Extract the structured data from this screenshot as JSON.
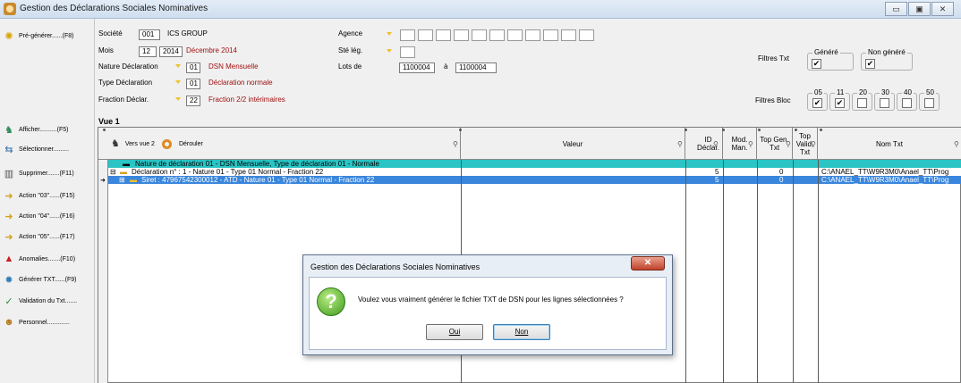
{
  "window": {
    "title": "Gestion des Déclarations Sociales Nominatives",
    "buttons": {
      "minimize": "▭",
      "maximize": "▣",
      "close": "✕"
    }
  },
  "sidebar": {
    "items": [
      {
        "label": "Pré-générer......(F8)",
        "icon": "gear-icon"
      },
      {
        "label": "Afficher..........(F5)",
        "icon": "binoculars-icon"
      },
      {
        "label": "Sélectionner.........",
        "icon": "select-icon"
      },
      {
        "label": "Supprimer.......(F11)",
        "icon": "trash-icon"
      },
      {
        "label": "Action \"03\"......(F15)",
        "icon": "arrow-right-icon"
      },
      {
        "label": "Action \"04\"......(F16)",
        "icon": "arrow-right-icon"
      },
      {
        "label": "Action \"05\"......(F17)",
        "icon": "arrow-right-icon"
      },
      {
        "label": "Anomalies.......(F10)",
        "icon": "warning-icon"
      },
      {
        "label": "Générer TXT......(F9)",
        "icon": "cog-icon"
      },
      {
        "label": "Validation du Txt.......",
        "icon": "check-circle-icon"
      },
      {
        "label": "Personnel.............",
        "icon": "people-icon"
      }
    ]
  },
  "form": {
    "societe": {
      "label": "Société",
      "code": "001",
      "name": "ICS GROUP"
    },
    "mois": {
      "label": "Mois",
      "month": "12",
      "year": "2014",
      "text": "Décembre 2014"
    },
    "nature": {
      "label": "Nature Déclaration",
      "code": "01",
      "text": "DSN Mensuelle"
    },
    "type": {
      "label": "Type Déclaration",
      "code": "01",
      "text": "Déclaration normale"
    },
    "fraction": {
      "label": "Fraction Déclar.",
      "code": "22",
      "text": "Fraction 2/2 intérimaires"
    },
    "agence": {
      "label": "Agence"
    },
    "steleg": {
      "label": "Sté lég."
    },
    "lots": {
      "label": "Lots de",
      "from": "1100004",
      "sep": "à",
      "to": "1100004"
    },
    "filtres_txt": {
      "label": "Filtres Txt",
      "genere": "Généré",
      "non_genere": "Non généré",
      "genere_checked": "✔",
      "non_genere_checked": "✔"
    },
    "filtres_bloc": {
      "label": "Filtres Bloc",
      "blocs": [
        {
          "code": "05",
          "mark": "✔"
        },
        {
          "code": "11",
          "mark": "✔"
        },
        {
          "code": "20",
          "mark": ""
        },
        {
          "code": "30",
          "mark": ""
        },
        {
          "code": "40",
          "mark": ""
        },
        {
          "code": "50",
          "mark": ""
        }
      ]
    }
  },
  "grid": {
    "vue_title": "Vue 1",
    "toolbar": {
      "vers_vue": "Vers vue 2",
      "derouler": "Dérouler"
    },
    "columns": {
      "valeur": "Valeur",
      "id_declar": "ID Déclar.",
      "mod_man": "Mod. Man.",
      "top_gen": "Top Gen. Txt",
      "top_valid": "Top Valid. Txt",
      "nom_txt": "Nom Txt"
    },
    "rows": [
      {
        "label": "Nature de déclaration 01 - DSN Mensuelle, Type de déclaration 01 - Normale",
        "id": "",
        "top_gen": "",
        "nom_txt": ""
      },
      {
        "label": "Déclaration n° : 1 - Nature 01 - Type 01 Normal - Fraction 22",
        "id": "5",
        "top_gen": "0",
        "nom_txt": "C:\\ANAEL_TT\\W9R3M0\\Anael_TT\\Prog"
      },
      {
        "label": "Siret : 47967542300012 - ATD - Nature 01 - Type 01 Normal - Fraction 22",
        "id": "5",
        "top_gen": "0",
        "nom_txt": "C:\\ANAEL_TT\\W9R3M0\\Anael_TT\\Prog"
      }
    ]
  },
  "dialog": {
    "title": "Gestion des Déclarations Sociales Nominatives",
    "close": "✕",
    "message": "Voulez vous vraiment générer le fichier TXT de DSN pour les lignes sélectionnées ?",
    "yes": "Oui",
    "no": "Non"
  },
  "colors": {
    "row_group": "#2ac4c4",
    "row_selected": "#3a86dc",
    "red_text": "#a01010"
  }
}
